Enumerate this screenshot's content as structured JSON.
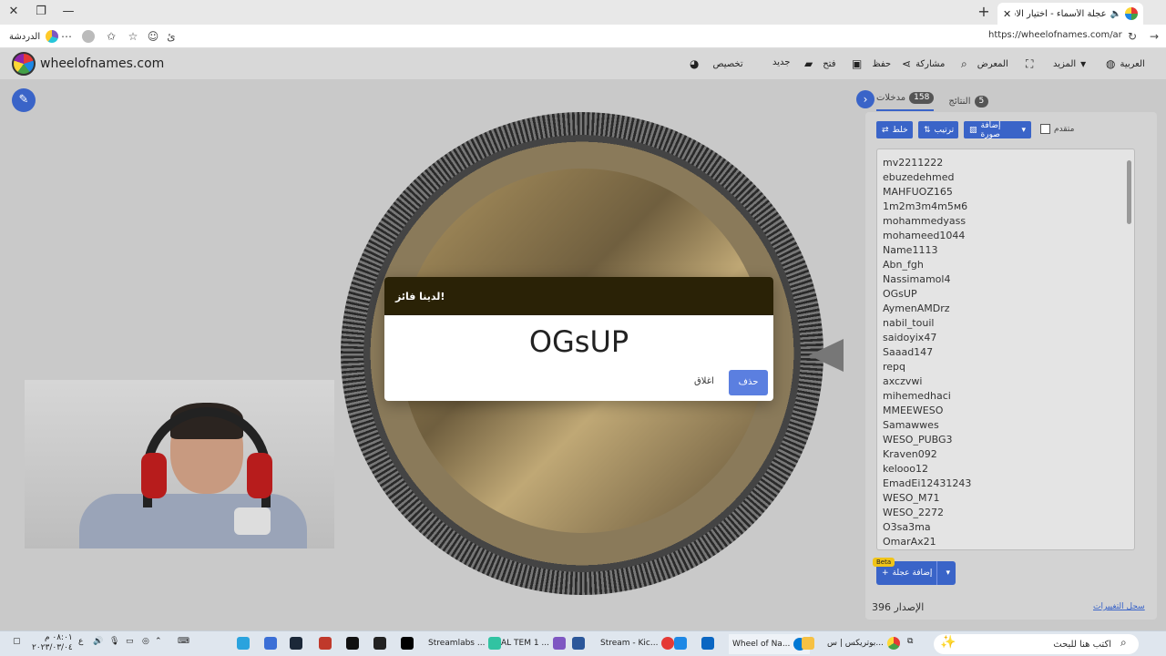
{
  "browser": {
    "tab_title": "عجلة الأسماء - اختيار الاسم العشوائي | Wheel of Names",
    "url": "https://wheelofnames.com/ar",
    "profile_label": "الدردشة"
  },
  "app": {
    "site_name": "wheelofnames.com",
    "menu": {
      "customize": "تخصيص",
      "new": "جديد",
      "open": "فتح",
      "save": "حفظ",
      "share": "مشاركة",
      "gallery": "المعرض",
      "more": "المزيد",
      "language": "العربية"
    }
  },
  "modal": {
    "title": "لدينا فائز!",
    "winner": "OGsUP",
    "close_label": "اغلاق",
    "remove_label": "حذف"
  },
  "panel": {
    "tab_entries": "مدخلات",
    "entries_count": "158",
    "tab_results": "النتائج",
    "results_count": "5",
    "shuffle_label": "خلط",
    "sort_label": "ترتيب",
    "add_image_label": "إضافة صورة",
    "advanced_label": "متقدم",
    "add_wheel_label": "إضافة عجلة",
    "beta": "Beta",
    "version": "الإصدار 396",
    "changelog": "سجل التغييرات",
    "entries": [
      "mv2211222",
      "ebuzedehmed",
      "MAHFUOZ165",
      "1m2m3m4m5ᴍ6",
      "mohammedyass",
      "mohameed1044",
      "Name1113",
      "Abn_fgh",
      "Nassimamol4",
      "OGsUP",
      "AymenAMDrz",
      "nabil_touil",
      "saidoyix47",
      "Saaad147",
      "repq",
      "axczvwi",
      "mihemedhaci",
      "MMEEWESO",
      "Samawwes",
      "WESO_PUBG3",
      "Kraven092",
      "kelooo12",
      "EmadEi12431243",
      "WESO_M71",
      "WESO_2272",
      "O3sa3ma",
      "OmarAx21"
    ]
  },
  "taskbar": {
    "search_placeholder": "اكتب هنا للبحث",
    "items": [
      "بوتريكس | س...",
      "Wheel of Na...",
      "Stream - Kic...",
      "AL TEM 1 ...",
      "Streamlabs ..."
    ],
    "time": "٠٨:٠١ م",
    "date": "٢٠٢٣/٠٣/٠٤",
    "lang": "ع"
  },
  "colors": {
    "accent": "#3a64c8",
    "modal_header": "#2a2206",
    "remove_btn": "#5b7fe0"
  }
}
